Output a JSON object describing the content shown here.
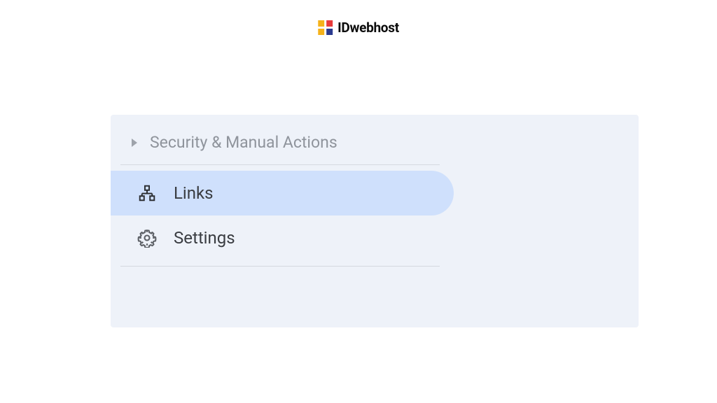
{
  "branding": {
    "name": "IDwebhost",
    "logo_colors": {
      "top_left": "#f5b21a",
      "top_right": "#e83a3a",
      "bottom_left": "#f5b21a",
      "bottom_right": "#2a3a8f"
    }
  },
  "sidebar": {
    "section_title": "Security & Manual Actions",
    "items": [
      {
        "label": "Links",
        "icon": "links-icon",
        "active": true
      },
      {
        "label": "Settings",
        "icon": "gear-icon",
        "active": false
      }
    ]
  }
}
